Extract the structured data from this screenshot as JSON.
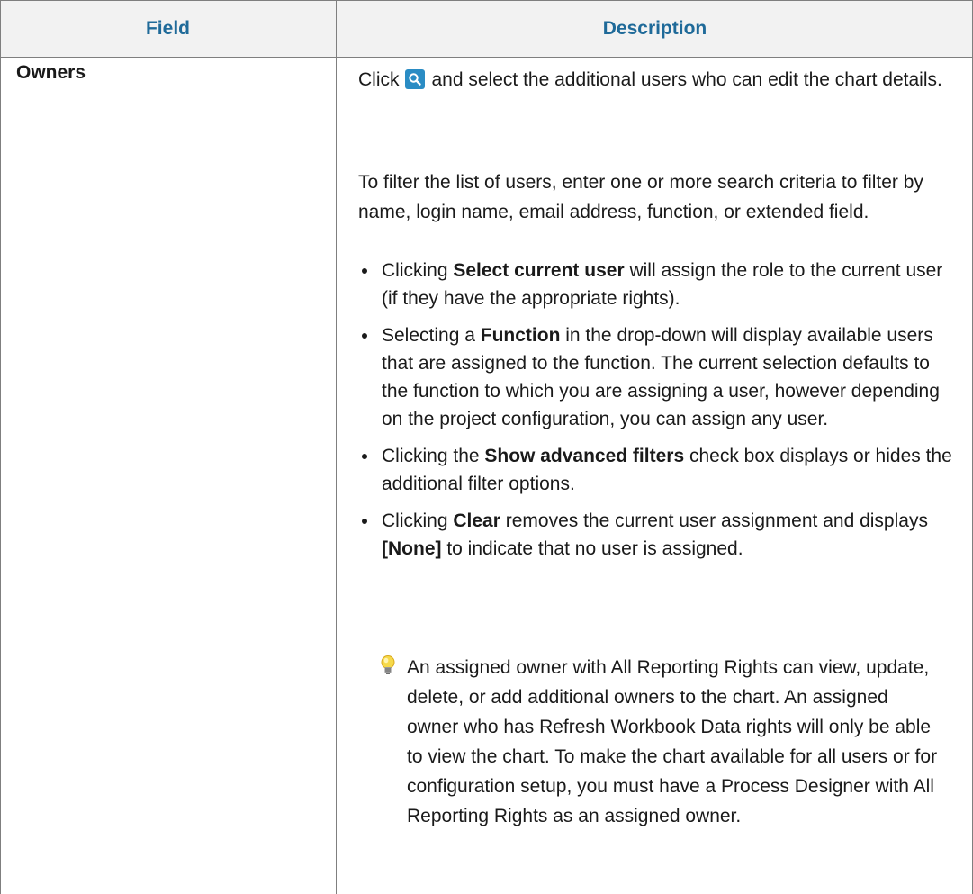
{
  "header": {
    "field": "Field",
    "description": "Description"
  },
  "row": {
    "field": "Owners",
    "p1_before": "Click",
    "p1_after": "and select the additional users who can edit the chart details.",
    "p2": "To filter the list of users, enter one or more search criteria to filter by name, login name, email address, function, or extended field.",
    "bullets": [
      {
        "pre": "Clicking ",
        "bold": "Select current user",
        "post": " will assign the role to the current user (if they have the appropriate rights)."
      },
      {
        "pre": "Selecting a ",
        "bold": "Function",
        "post": " in the drop-down will display available users that are assigned to the function. The current selection defaults to the function to which you are assigning a user, however depending on the project configuration, you can assign any user."
      },
      {
        "pre": "Clicking the ",
        "bold": "Show advanced filters",
        "post": " check box displays or hides the additional filter options."
      },
      {
        "pre": "Clicking ",
        "bold": "Clear",
        "post": " removes the current user assignment and displays ",
        "bold2": "[None]",
        "post2": " to indicate that no user is assigned."
      }
    ],
    "tip": "An assigned owner with All Reporting Rights can view, update, delete, or add additional owners to the chart. An assigned owner who has Refresh Workbook Data rights will only be able to view the chart. To make the chart available for all users or for configuration setup, you must have a Process Designer with All Reporting Rights as an assigned owner."
  },
  "icons": {
    "search": "search-icon",
    "tip": "lightbulb-icon"
  },
  "colors": {
    "header_text": "#1f6a99",
    "header_bg": "#f2f2f2",
    "icon_bg": "#2a8cc4"
  }
}
